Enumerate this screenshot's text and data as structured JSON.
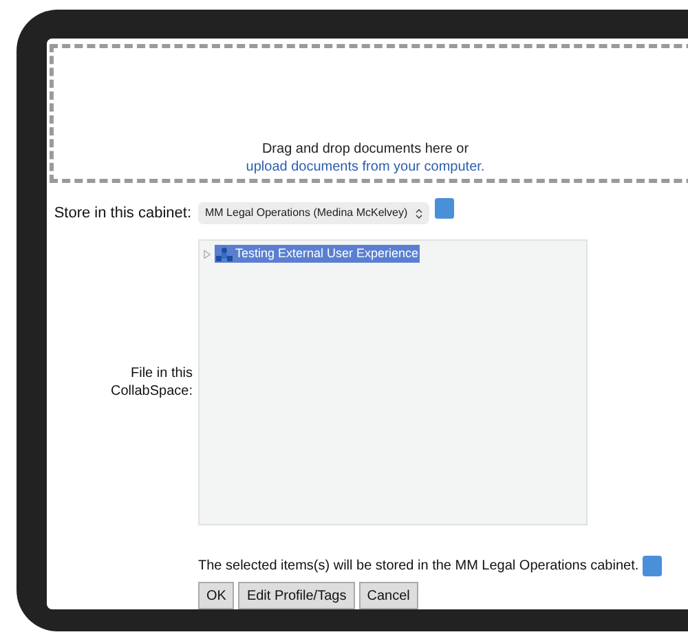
{
  "dropzone": {
    "text": "Drag and drop documents here or",
    "link": "upload documents from your computer."
  },
  "cabinet": {
    "label": "Store in this cabinet:",
    "value": "MM Legal Operations (Medina McKelvey)"
  },
  "collabspace": {
    "label": "File in this CollabSpace:",
    "items": [
      {
        "label": "Testing External User Experience",
        "selected": true,
        "expanded": false
      }
    ]
  },
  "message": "The selected items(s) will be stored in the MM Legal Operations cabinet.",
  "buttons": [
    "OK",
    "Edit Profile/Tags",
    "Cancel"
  ]
}
